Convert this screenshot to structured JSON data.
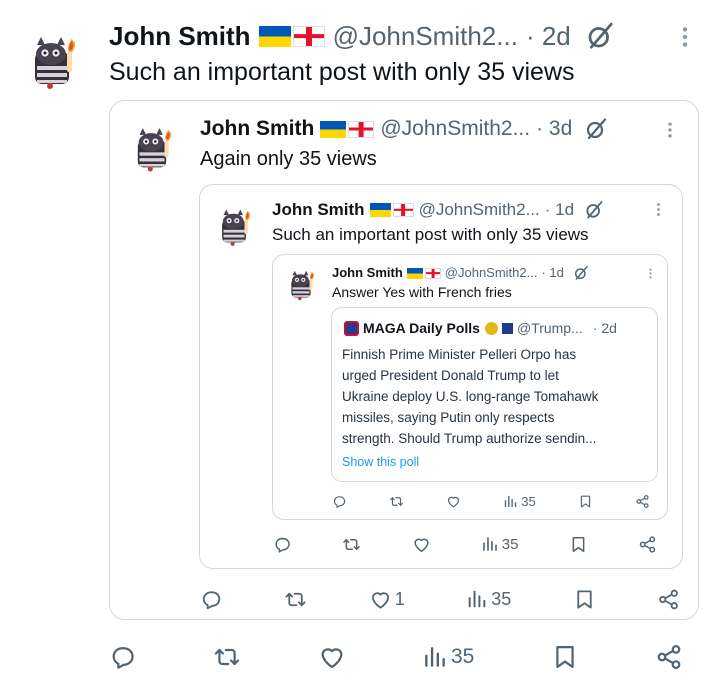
{
  "post": {
    "author": "John Smith",
    "handle": "@JohnSmith2...",
    "time": "· 2d",
    "text": "Such an important post with only 35 views",
    "actions": {
      "likes": "",
      "views": "35"
    }
  },
  "quote1": {
    "author": "John Smith",
    "handle": "@JohnSmith2...",
    "time": "· 3d",
    "text": "Again only 35 views",
    "actions": {
      "likes": "1",
      "views": "35"
    }
  },
  "quote2": {
    "author": "John Smith",
    "handle": "@JohnSmith2...",
    "time": "· 1d",
    "text": "Such an important post with only 35 views",
    "actions": {
      "views": "35"
    }
  },
  "quote3": {
    "author": "John Smith",
    "handle": "@JohnSmith2...",
    "time": "· 1d",
    "text": "Answer Yes with French fries",
    "actions": {
      "views": "35"
    }
  },
  "quote4": {
    "author": "MAGA Daily Polls",
    "handle": "@Trump...",
    "time": "· 2d",
    "lines": [
      "Finnish Prime Minister Pelleri Orpo has",
      "urged President Donald Trump to let",
      "Ukraine deploy U.S. long-range Tomahawk",
      "missiles, saying Putin only respects",
      "strength. Should Trump authorize sendin..."
    ],
    "poll_link": "Show this poll"
  },
  "colors": {
    "accent": "#1d9bf0",
    "muted": "#536471",
    "border": "#cfd9de",
    "verified": "#e2b719"
  }
}
